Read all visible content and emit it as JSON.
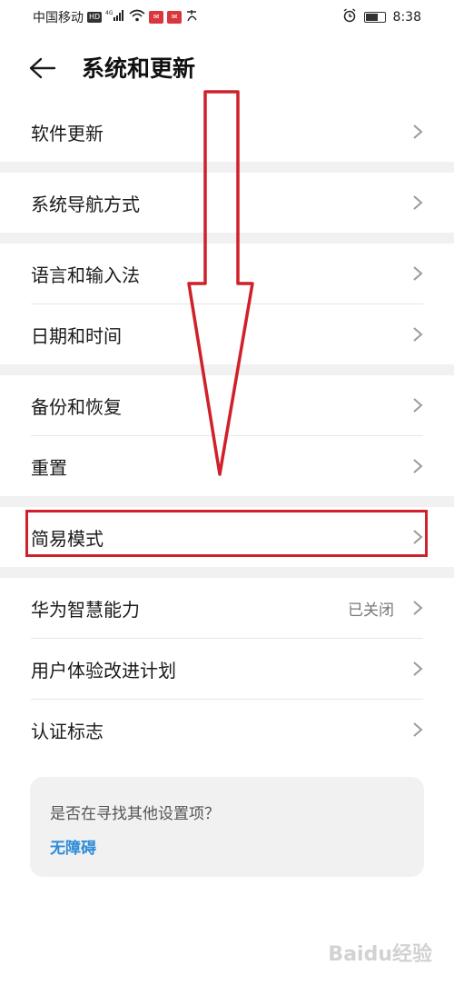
{
  "status_bar": {
    "carrier": "中国移动",
    "hd": "HD",
    "network": "4G",
    "time": "8:38",
    "battery_level": 0.7
  },
  "header": {
    "back_icon": "arrow-left-icon",
    "title": "系统和更新"
  },
  "groups": [
    {
      "items": [
        {
          "label": "软件更新",
          "value": ""
        }
      ]
    },
    {
      "items": [
        {
          "label": "系统导航方式",
          "value": ""
        }
      ]
    },
    {
      "items": [
        {
          "label": "语言和输入法",
          "value": ""
        },
        {
          "label": "日期和时间",
          "value": ""
        }
      ]
    },
    {
      "items": [
        {
          "label": "备份和恢复",
          "value": ""
        },
        {
          "label": "重置",
          "value": ""
        }
      ]
    },
    {
      "items": [
        {
          "label": "简易模式",
          "value": ""
        }
      ]
    },
    {
      "items": [
        {
          "label": "华为智慧能力",
          "value": "已关闭"
        },
        {
          "label": "用户体验改进计划",
          "value": ""
        },
        {
          "label": "认证标志",
          "value": ""
        }
      ]
    }
  ],
  "suggestion_card": {
    "question": "是否在寻找其他设置项？",
    "link": "无障碍"
  },
  "annotation_color": "#d0202a",
  "link_color": "#2d8cd8",
  "watermark": "Baidu经验"
}
